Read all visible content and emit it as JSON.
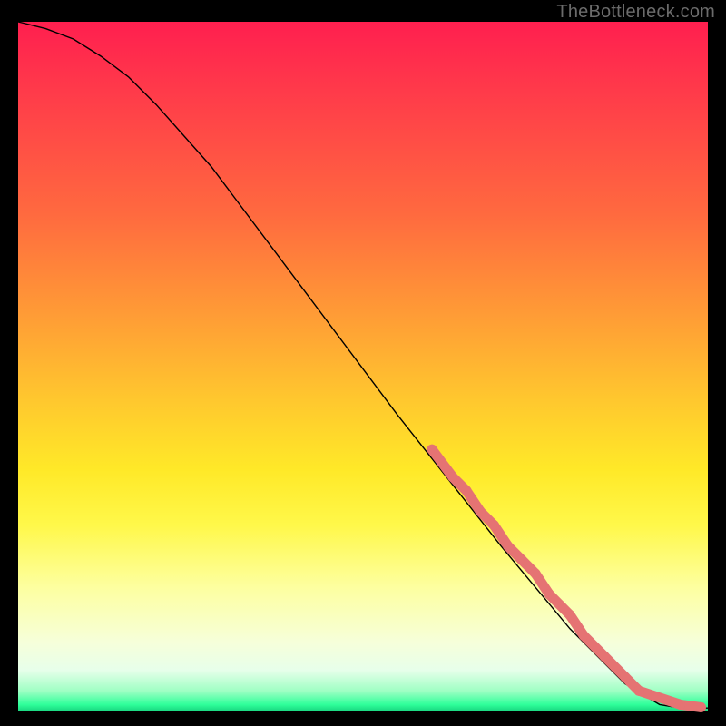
{
  "watermark": "TheBottleneck.com",
  "chart_data": {
    "type": "line",
    "title": "",
    "xlabel": "",
    "ylabel": "",
    "xlim": [
      0,
      100
    ],
    "ylim": [
      0,
      100
    ],
    "curve": {
      "name": "bottleneck-curve",
      "x": [
        0,
        4,
        8,
        12,
        16,
        20,
        28,
        40,
        55,
        70,
        80,
        88,
        93,
        96,
        100
      ],
      "y": [
        100,
        99,
        97.5,
        95,
        92,
        88,
        79,
        63,
        43,
        24,
        12,
        4,
        1,
        0.5,
        0.5
      ]
    },
    "highlight_points": {
      "name": "highlighted-range",
      "color": "#e57373",
      "x": [
        60,
        63,
        65,
        67,
        69,
        71,
        73,
        75,
        77,
        80,
        82,
        85,
        88,
        90,
        96,
        99
      ],
      "y": [
        38,
        34,
        32,
        29,
        27,
        24,
        22,
        20,
        17,
        14,
        11,
        8,
        5,
        3,
        1,
        0.6
      ]
    }
  }
}
